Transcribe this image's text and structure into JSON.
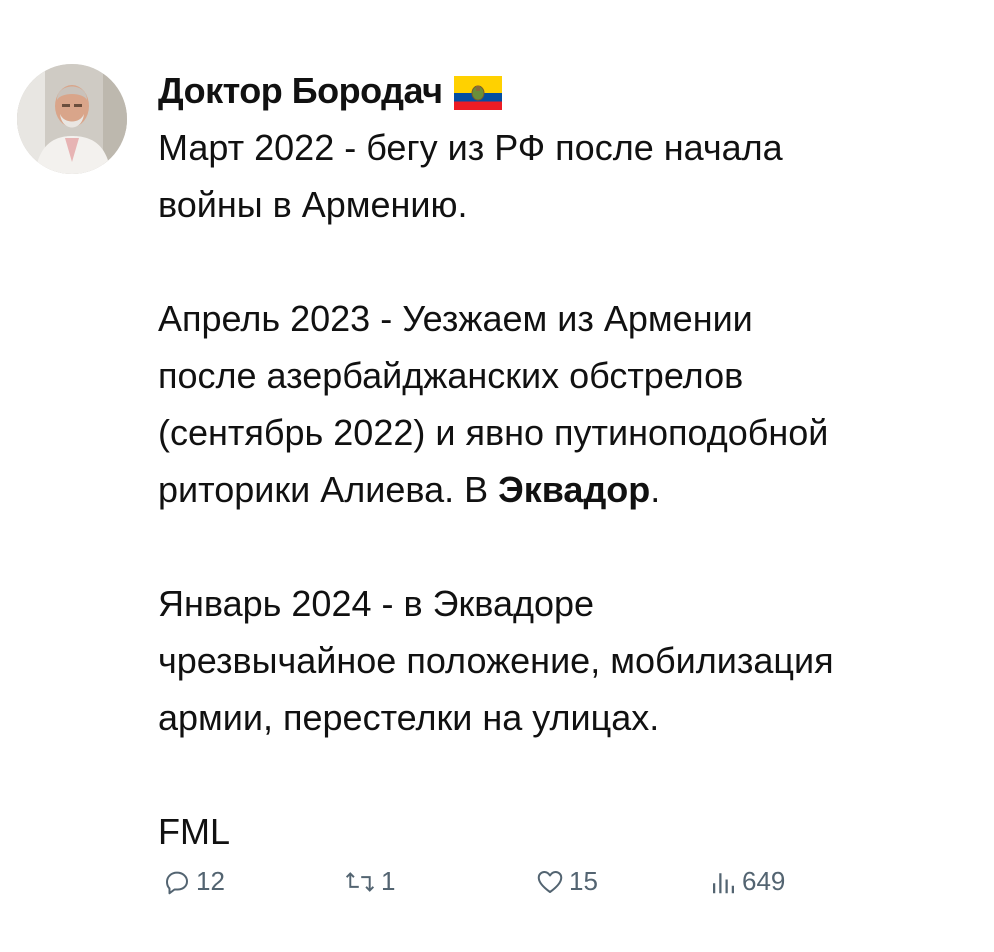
{
  "post": {
    "author_name": "Доктор Бородач",
    "author_flag": "ecuador-flag-icon",
    "paragraphs": [
      {
        "lines": [
          "Март 2022 - бегу из РФ после начала",
          "войны в Армению."
        ]
      },
      {
        "lines": [
          "Апрель 2023 - Уезжаем из Армении",
          "после азербайджанских обстрелов",
          "(сентябрь 2022) и явно путиноподобной"
        ],
        "last_line_prefix": "риторики Алиева. В ",
        "last_line_bold": "Эквадор",
        "last_line_suffix": "."
      },
      {
        "lines": [
          "Январь 2024 - в Эквадоре",
          "чрезвычайное положение, мобилизация",
          "армии, перестелки на улицах."
        ]
      },
      {
        "lines": [
          "FML"
        ]
      }
    ]
  },
  "actions": {
    "reply_count": "12",
    "repost_count": "1",
    "like_count": "15",
    "views_count": "649",
    "icon_color": "#536471"
  },
  "colors": {
    "text": "#111111",
    "background": "#ffffff",
    "flag_yellow": "#FFD100",
    "flag_blue": "#034EA2",
    "flag_red": "#ED1C24"
  }
}
